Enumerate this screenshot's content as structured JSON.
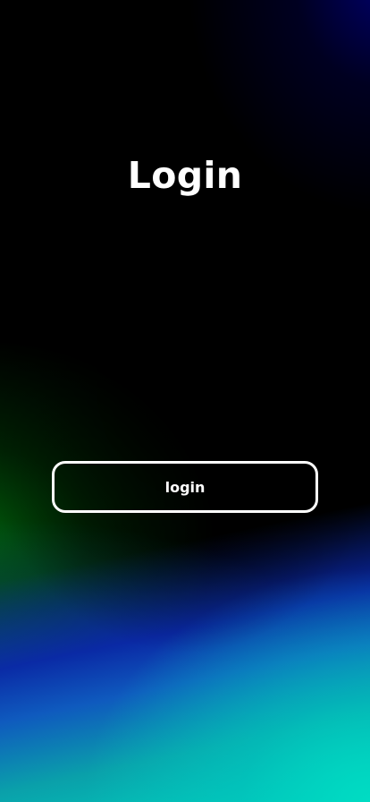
{
  "page": {
    "title": "Login"
  },
  "actions": {
    "login_label": "login"
  },
  "colors": {
    "text": "#ffffff",
    "background": "#000000",
    "accent_green": "#005a0a",
    "accent_blue": "#0a28aa",
    "accent_teal": "#00d2be"
  }
}
